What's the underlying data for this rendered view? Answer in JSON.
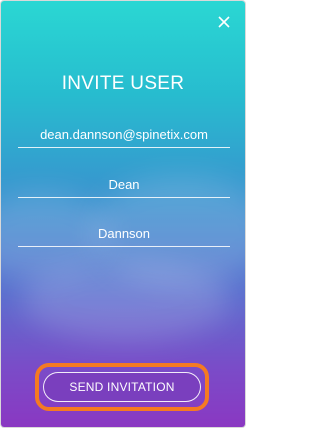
{
  "modal": {
    "title": "INVITE USER",
    "close_icon": "close-icon",
    "fields": [
      {
        "name": "email",
        "value": "dean.dannson@spinetix.com"
      },
      {
        "name": "first_name",
        "value": "Dean"
      },
      {
        "name": "last_name",
        "value": "Dannson"
      }
    ],
    "send_label": "SEND INVITATION"
  },
  "colors": {
    "gradient_top": "#2ad7d3",
    "gradient_bottom": "#8a38c2",
    "highlight": "#f57a22",
    "text": "#ffffff"
  }
}
